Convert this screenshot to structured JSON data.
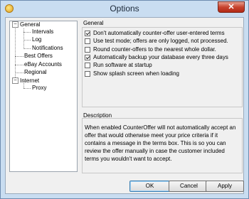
{
  "window": {
    "title": "Options",
    "close_glyph": "✕"
  },
  "tree": {
    "items": [
      {
        "label": "General",
        "expander": "−"
      },
      {
        "label": "Intervals"
      },
      {
        "label": "Log"
      },
      {
        "label": "Notifications"
      },
      {
        "label": "Best Offers"
      },
      {
        "label": "eBay Accounts"
      },
      {
        "label": "Regional"
      },
      {
        "label": "Internet",
        "expander": "−"
      },
      {
        "label": "Proxy"
      }
    ]
  },
  "general": {
    "heading": "General",
    "options": [
      {
        "label": "Don't automatically counter-offer user-entered terms",
        "checked": true
      },
      {
        "label": "Use test mode; offers are only logged, not processed.",
        "checked": false
      },
      {
        "label": "Round counter-offers to the nearest whole dollar.",
        "checked": false
      },
      {
        "label": "Automatically backup your database every three days",
        "checked": true
      },
      {
        "label": "Run software at startup",
        "checked": false
      },
      {
        "label": "Show splash screen when loading",
        "checked": false
      }
    ]
  },
  "description": {
    "heading": "Description",
    "text": "When enabled CounterOffer will not automatically accept an offer that would otherwise meet your price criteria if it contains a message in the terms box. This is so you can review the offer manually in case the customer included terms you wouldn't want to accept."
  },
  "buttons": {
    "ok": "OK",
    "cancel": "Cancel",
    "apply": "Apply"
  }
}
